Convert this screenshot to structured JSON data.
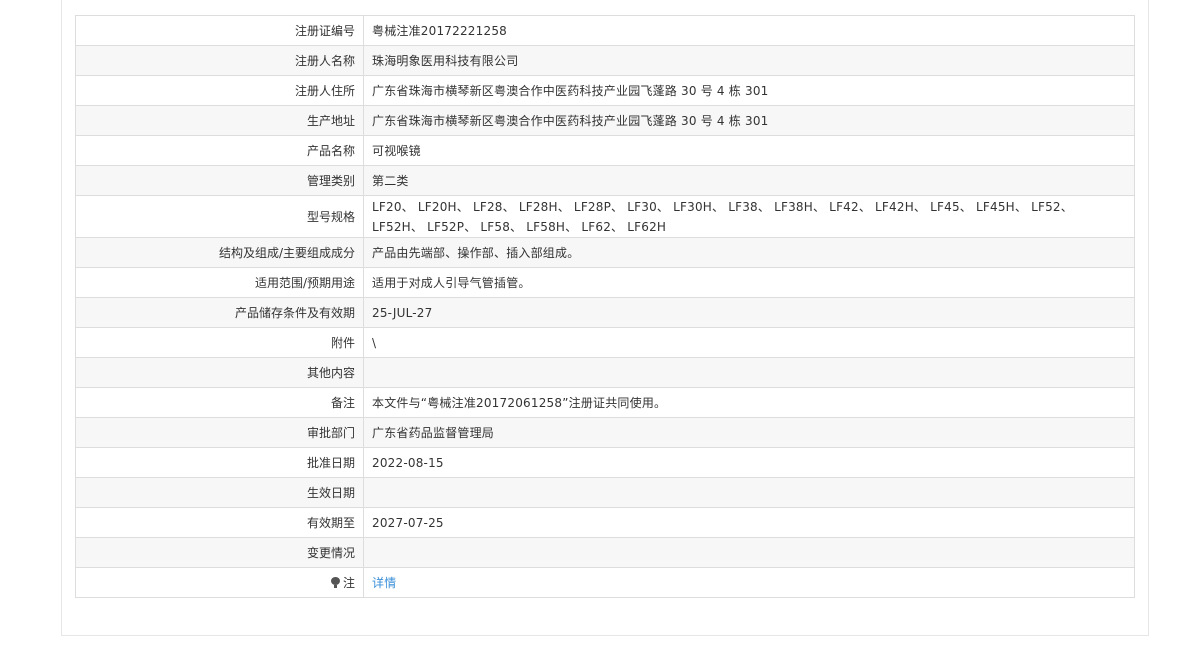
{
  "rows": [
    {
      "label": "注册证编号",
      "value": "粤械注准20172221258"
    },
    {
      "label": "注册人名称",
      "value": "珠海明象医用科技有限公司"
    },
    {
      "label": "注册人住所",
      "value": "广东省珠海市横琴新区粤澳合作中医药科技产业园飞蓬路 30 号 4 栋 301"
    },
    {
      "label": "生产地址",
      "value": "广东省珠海市横琴新区粤澳合作中医药科技产业园飞蓬路 30 号 4 栋 301"
    },
    {
      "label": "产品名称",
      "value": "可视喉镜"
    },
    {
      "label": "管理类别",
      "value": "第二类"
    },
    {
      "label": "型号规格",
      "value": "LF20、 LF20H、 LF28、 LF28H、 LF28P、 LF30、 LF30H、 LF38、 LF38H、 LF42、 LF42H、 LF45、 LF45H、 LF52、 LF52H、 LF52P、 LF58、 LF58H、 LF62、 LF62H"
    },
    {
      "label": "结构及组成/主要组成成分",
      "value": "产品由先端部、操作部、插入部组成。"
    },
    {
      "label": "适用范围/预期用途",
      "value": "适用于对成人引导气管插管。"
    },
    {
      "label": "产品储存条件及有效期",
      "value": "25-JUL-27"
    },
    {
      "label": "附件",
      "value": "\\"
    },
    {
      "label": "其他内容",
      "value": ""
    },
    {
      "label": "备注",
      "value": "本文件与“粤械注准20172061258”注册证共同使用。"
    },
    {
      "label": "审批部门",
      "value": "广东省药品监督管理局"
    },
    {
      "label": "批准日期",
      "value": "2022-08-15"
    },
    {
      "label": "生效日期",
      "value": ""
    },
    {
      "label": "有效期至",
      "value": "2027-07-25"
    },
    {
      "label": "变更情况",
      "value": ""
    }
  ],
  "note": {
    "icon": "bulb-icon",
    "label": "注",
    "link_text": "详情",
    "link_color": "#3a8fd8"
  }
}
